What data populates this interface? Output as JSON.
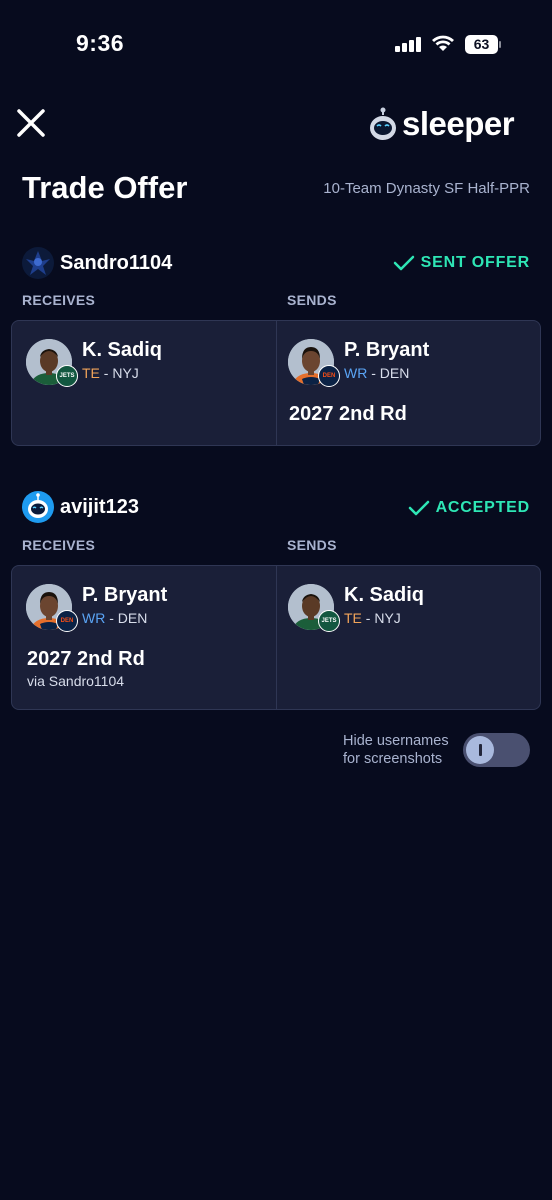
{
  "status_bar": {
    "time": "9:36",
    "battery": "63"
  },
  "header": {
    "logo_text": "sleeper"
  },
  "page": {
    "title": "Trade Offer",
    "league": "10-Team Dynasty SF Half-PPR"
  },
  "trades": [
    {
      "user": "Sandro1104",
      "status": "SENT OFFER",
      "receives_label": "RECEIVES",
      "sends_label": "SENDS",
      "receives": {
        "name": "K. Sadiq",
        "pos": "TE",
        "team": " - NYJ"
      },
      "sends": {
        "name": "P. Bryant",
        "pos": "WR",
        "team": " - DEN",
        "pick": "2027 2nd Rd"
      }
    },
    {
      "user": "avijit123",
      "status": "ACCEPTED",
      "receives_label": "RECEIVES",
      "sends_label": "SENDS",
      "receives": {
        "name": "P. Bryant",
        "pos": "WR",
        "team": " - DEN",
        "pick": "2027 2nd Rd",
        "via": "via Sandro1104"
      },
      "sends": {
        "name": "K. Sadiq",
        "pos": "TE",
        "team": " - NYJ"
      }
    }
  ],
  "footer": {
    "hide_line1": "Hide usernames",
    "hide_line2": "for screenshots"
  },
  "colors": {
    "background": "#070b1e",
    "card": "#1a1f38",
    "accent": "#2ee6b5",
    "te": "#f2a45a",
    "wr": "#5aa4f5"
  }
}
